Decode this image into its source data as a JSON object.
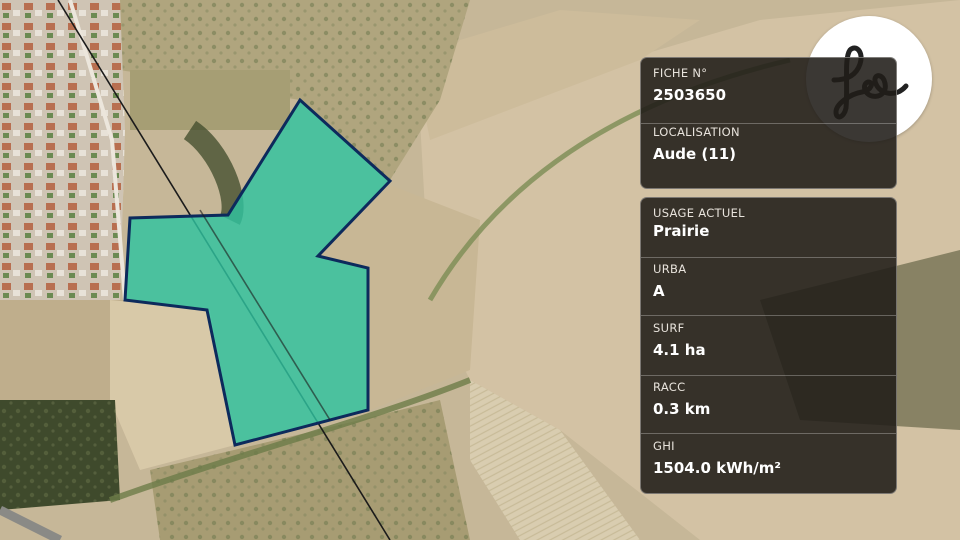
{
  "colors": {
    "parcel_fill": "#2fc3a0",
    "parcel_stroke": "#0d2a5c",
    "card_bg": "#201c18",
    "logo_bg": "#ffffff",
    "logo_ink": "#222222"
  },
  "logo": {
    "text": "fs",
    "icon": "fs-monogram-logo"
  },
  "fiche": {
    "label": "FICHE N°",
    "value": "2503650"
  },
  "localisation": {
    "label": "LOCALISATION",
    "value": "Aude (11)"
  },
  "usage": {
    "label": "USAGE ACTUEL",
    "value": "Prairie"
  },
  "urba": {
    "label": "URBA",
    "value": "A"
  },
  "surf": {
    "label": "SURF",
    "value": "4.1 ha"
  },
  "racc": {
    "label": "RACC",
    "value": "0.3 km"
  },
  "ghi": {
    "label": "GHI",
    "value": "1504.0 kWh/m²"
  }
}
